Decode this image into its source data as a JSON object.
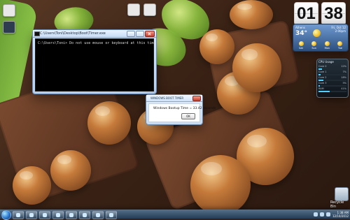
{
  "console_window": {
    "title": "C:\\Users\\Toni\\Desktop\\Boot\\Timer.exe",
    "output_line": "C:\\Users\\Toni> Do not use mouse or keyboard at this time"
  },
  "dialog": {
    "title": "WINDOWS BOOT TIMER",
    "message": "Windows Bootup Time = 33.42 seconds",
    "ok_label": "OK"
  },
  "clock": {
    "hours": "01",
    "minutes": "38"
  },
  "weather": {
    "location": "Athens",
    "temperature": "34°",
    "date_line": "Fri, Oct 12",
    "date_line2": "2:00pm",
    "forecast": [
      {
        "day": "Sat"
      },
      {
        "day": "Sun"
      },
      {
        "day": "Mon"
      },
      {
        "day": "Tue"
      }
    ]
  },
  "cpu_gadget": {
    "title": "CPU Usage",
    "rows": [
      {
        "label": "Core 0",
        "value": "12%",
        "level": 0.12
      },
      {
        "label": "Core 1",
        "value": "7%",
        "level": 0.07
      },
      {
        "label": "Core 2",
        "value": "18%",
        "level": 0.18
      },
      {
        "label": "Core 3",
        "value": "5%",
        "level": 0.05
      },
      {
        "label": "RAM",
        "value": "41%",
        "level": 0.41
      }
    ]
  },
  "desktop": {
    "recycle_bin_label": "Recycle Bin"
  },
  "taskbar": {
    "tray_time": "1:38 AM",
    "tray_date": "12/10/2012"
  }
}
